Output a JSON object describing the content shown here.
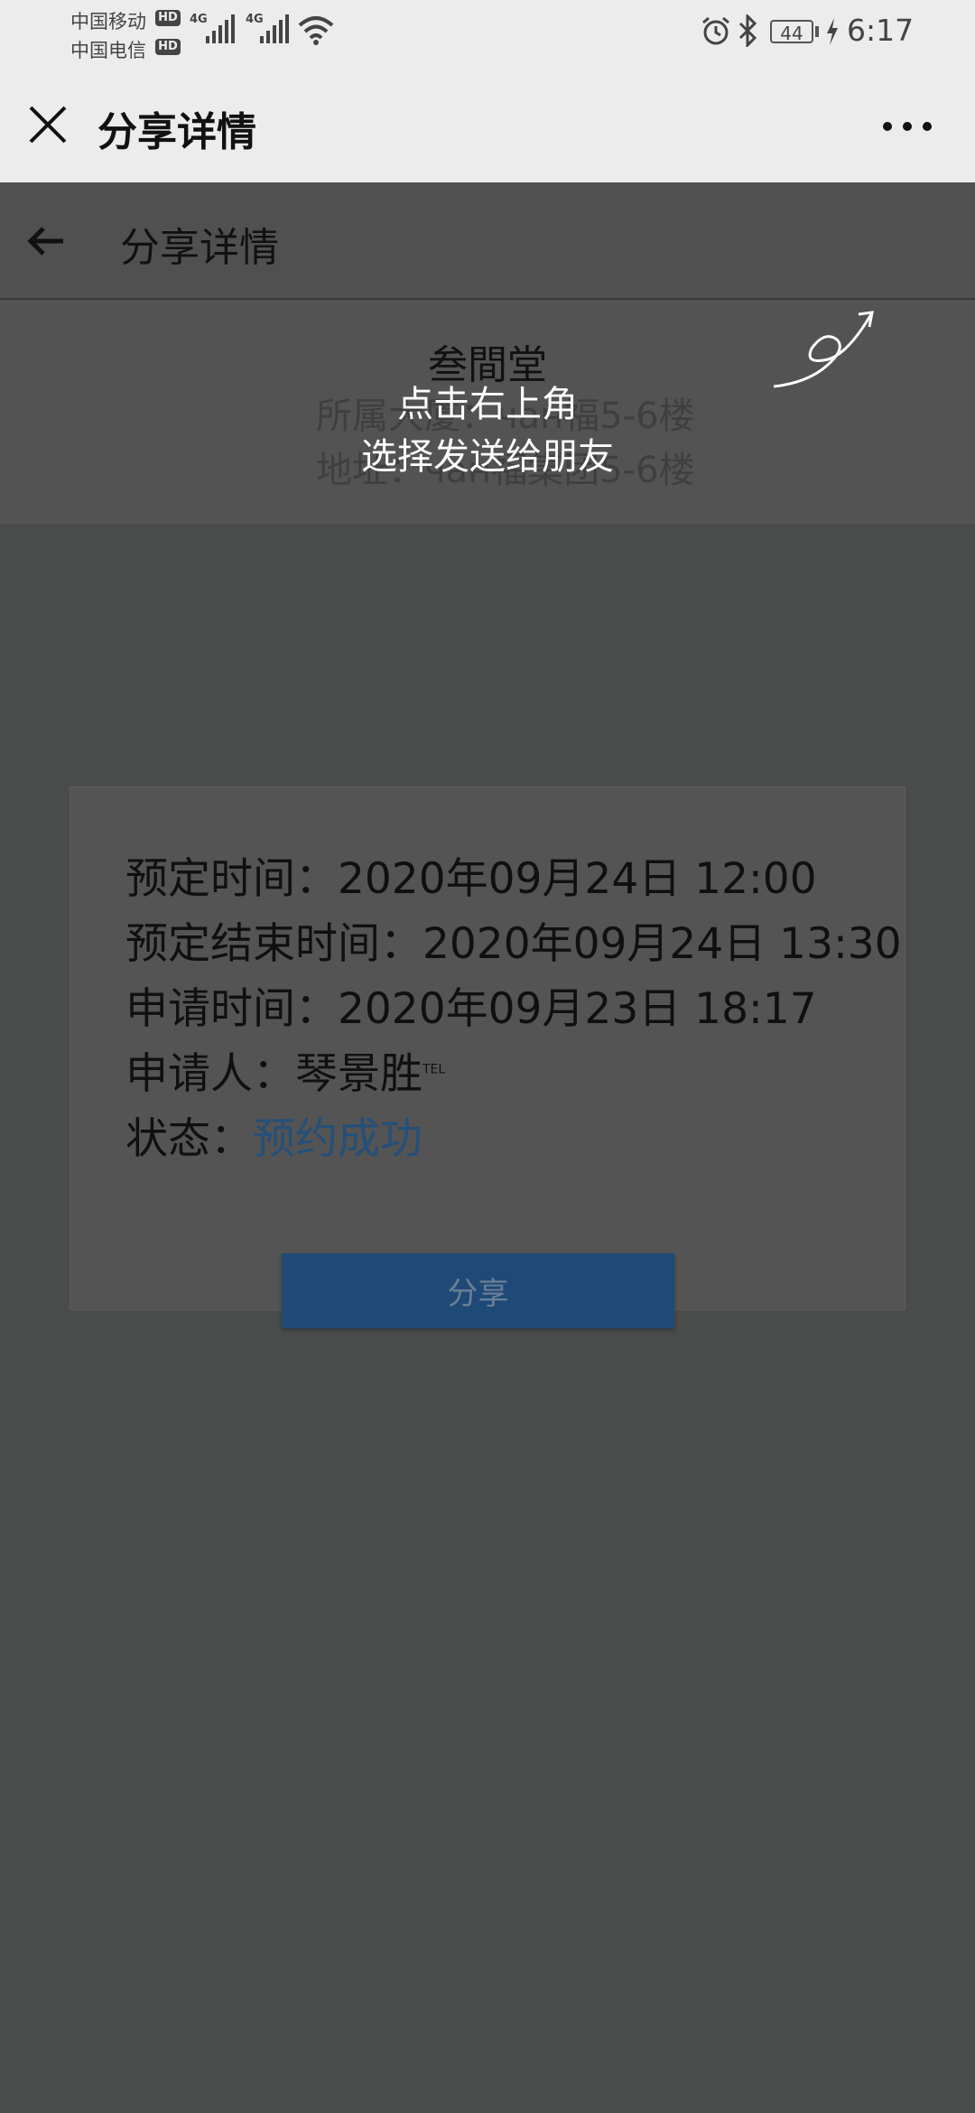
{
  "status_bar": {
    "carrier1": "中国移动",
    "carrier2": "中国电信",
    "hd_badge": "HD",
    "network1": "4G",
    "network2": "4G",
    "battery": "44",
    "time": "6:17",
    "icons": [
      "signal-icon",
      "wifi-icon",
      "alarm-icon",
      "bluetooth-icon",
      "battery-icon",
      "charging-icon"
    ]
  },
  "wechat_bar": {
    "title": "分享详情",
    "icons": [
      "close-icon",
      "more-icon"
    ]
  },
  "page_header": {
    "title": "分享详情",
    "icon": "back-arrow-icon"
  },
  "venue": {
    "name": "叁間堂",
    "building": "所属大厦：чан福5-6楼",
    "address": "地址：чан福集团5-6楼"
  },
  "overlay": {
    "line1": "点击右上角",
    "line2": "选择发送给朋友",
    "icon": "curved-arrow-icon"
  },
  "booking": {
    "start": "预定时间：2020年09月24日 12:00",
    "end": "预定结束时间：2020年09月24日 13:30",
    "applied": "申请时间：2020年09月23日 18:17",
    "applicant_label": "申请人：",
    "applicant_name": "琴景胜",
    "applicant_tel": "TEL",
    "status_label": "状态：",
    "status_value": "预约成功"
  },
  "share_button": "分享",
  "colors": {
    "status_success": "#254f78",
    "share_button_bg": "#1f4a78",
    "overlay_dim": "#4a4b4b"
  }
}
